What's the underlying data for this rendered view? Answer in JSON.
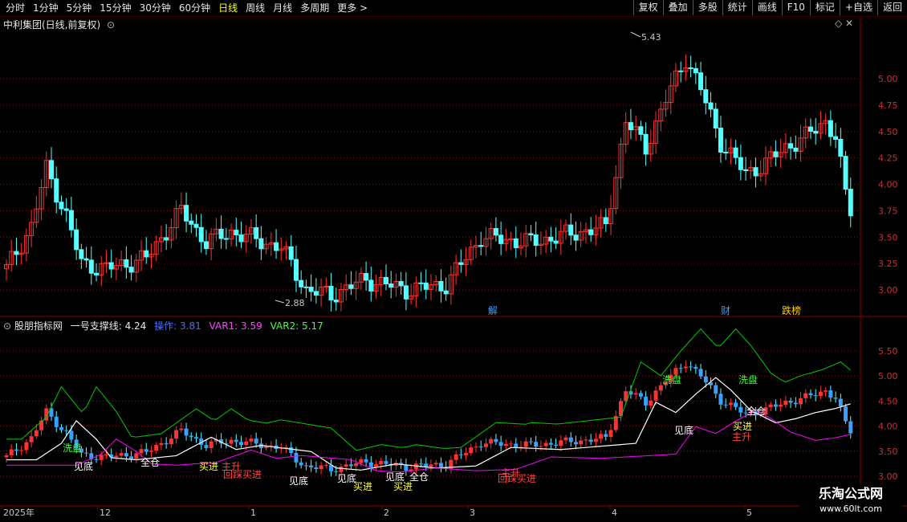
{
  "toolbar": {
    "periods": [
      "分时",
      "1分钟",
      "5分钟",
      "15分钟",
      "30分钟",
      "60分钟",
      "日线",
      "周线",
      "月线",
      "多周期",
      "更多 >"
    ],
    "active_period": "日线",
    "actions": [
      "复权",
      "叠加",
      "多股",
      "统计",
      "画线",
      "F10",
      "标记",
      "+自选",
      "返回"
    ]
  },
  "main_pane": {
    "title": "中利集团(日线,前复权)",
    "y_ticks": [
      "5.00",
      "4.75",
      "4.50",
      "4.25",
      "4.00",
      "3.75",
      "3.50",
      "3.25",
      "3.00"
    ],
    "high_label": "5.43",
    "low_label": "2.88",
    "markers": [
      "解",
      "财",
      "跌榜"
    ]
  },
  "indicator_pane": {
    "name": "股朋指标网",
    "line1": "一号支撑线: 4.24",
    "line2": "操作: 3.81",
    "line3": "VAR1: 3.59",
    "line4": "VAR2: 5.17",
    "y_ticks": [
      "5.50",
      "5.00",
      "4.50",
      "4.00",
      "3.50",
      "3.00"
    ],
    "signals": [
      "见底",
      "洗盘",
      "买进",
      "全仓",
      "见底",
      "见底",
      "买进",
      "回踩买进",
      "主升",
      "见底",
      "全仓",
      "买进",
      "回踩买进",
      "主升",
      "洗盘",
      "洗盘",
      "全仓",
      "买进",
      "主升",
      "见底"
    ]
  },
  "x_axis": {
    "labels": [
      "2025年",
      "12",
      "1",
      "2",
      "3",
      "4",
      "5"
    ]
  },
  "watermark": {
    "title": "乐淘公式网",
    "url": "www.60lt.com"
  },
  "colors": {
    "up": "#ff3232",
    "down": "#54ffff",
    "grid": "#7a1010",
    "support": "#ffffff",
    "magenta": "#ff00ff",
    "green_line": "#00cc00"
  },
  "chart_data": {
    "type": "candlestick",
    "title": "中利集团(日线,前复权)",
    "ylim": [
      2.8,
      5.6
    ],
    "max_price": 5.43,
    "min_price": 2.88,
    "x_ticks": [
      "2025年",
      "12",
      "1",
      "2",
      "3",
      "4",
      "5"
    ]
  }
}
